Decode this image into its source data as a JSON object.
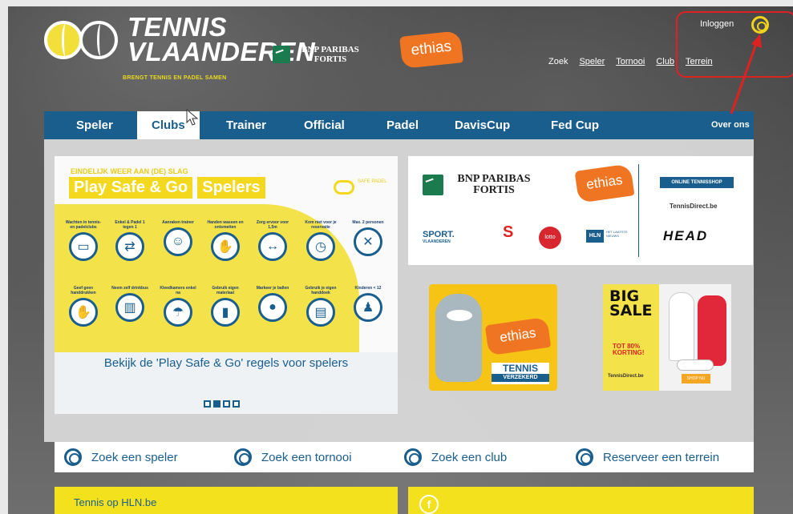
{
  "header": {
    "logo_line1": "TENNIS",
    "logo_line2": "VLAANDEREN",
    "logo_tagline": "BRENGT TENNIS EN PADEL SAMEN",
    "sponsor_bnp": "BNP PARIBAS FORTIS",
    "sponsor_ethias": "ethias",
    "login_label": "Inloggen",
    "top_links": [
      "Zoek",
      "Speler",
      "Tornooi",
      "Club",
      "Terrein"
    ]
  },
  "nav": {
    "items": [
      "Speler",
      "Clubs",
      "Trainer",
      "Official",
      "Padel",
      "DavisCup",
      "Fed Cup"
    ],
    "right": "Over ons",
    "active_index": 1
  },
  "promo": {
    "kicker": "EINDELIJK WEER AAN (DE) SLAG",
    "title_a": "Play Safe & Go",
    "title_b": "Spelers",
    "logo_text": "SAFE PADEL",
    "rules_row1": [
      "Wachten in tennis- en padelclubs",
      "Enkel & Padel 1 tegen 1",
      "Aanraken trainer",
      "Handen wassen en ontsmetten",
      "Zorg ervoor voor 1,5m",
      "Kom niet voor je reservatie",
      "Max. 2 personen"
    ],
    "rules_row2": [
      "Geef geen handdrukken",
      "Neem zelf drinkbus",
      "Kleedkamers enkel na",
      "Gebruik eigen materiaal",
      "Markeer je ballen",
      "Gebruik je eigen handdoek",
      "Kinderen < 12"
    ],
    "caption": "Bekijk de 'Play Safe & Go' regels voor spelers",
    "slides": 4,
    "active_slide": 2
  },
  "sponsors": {
    "bnp": "BNP PARIBAS FORTIS",
    "ethias": "ethias",
    "shop": "ONLINE TENNISSHOP",
    "tennisdirect": "TennisDirect.be",
    "head": "HEAD",
    "sport": "SPORT.",
    "sport_sub": "VLAANDEREN",
    "sporza": "S",
    "lotto": "lotto",
    "hln": "HLN",
    "hln_sub": "HET LAATSTE NIEUWS"
  },
  "ad_ethias": {
    "brand": "ethias",
    "line1": "TENNIS",
    "line2": "VERZEKERD"
  },
  "ad_sale": {
    "big": "BIG",
    "sale": "SALE",
    "korting": "TOT 80% KORTING!",
    "brand": "TennisDirect.be",
    "shop": "SHOP NU"
  },
  "search": {
    "items": [
      "Zoek een speler",
      "Zoek een tornooi",
      "Zoek een club",
      "Reserveer een terrein"
    ]
  },
  "bottom": {
    "left": "Tennis op HLN.be",
    "fb_icon": "f"
  },
  "colors": {
    "primary_blue": "#1a5e8e",
    "yellow": "#f4e11d",
    "ethias_orange": "#f07522",
    "annotation_red": "#dd2222"
  }
}
